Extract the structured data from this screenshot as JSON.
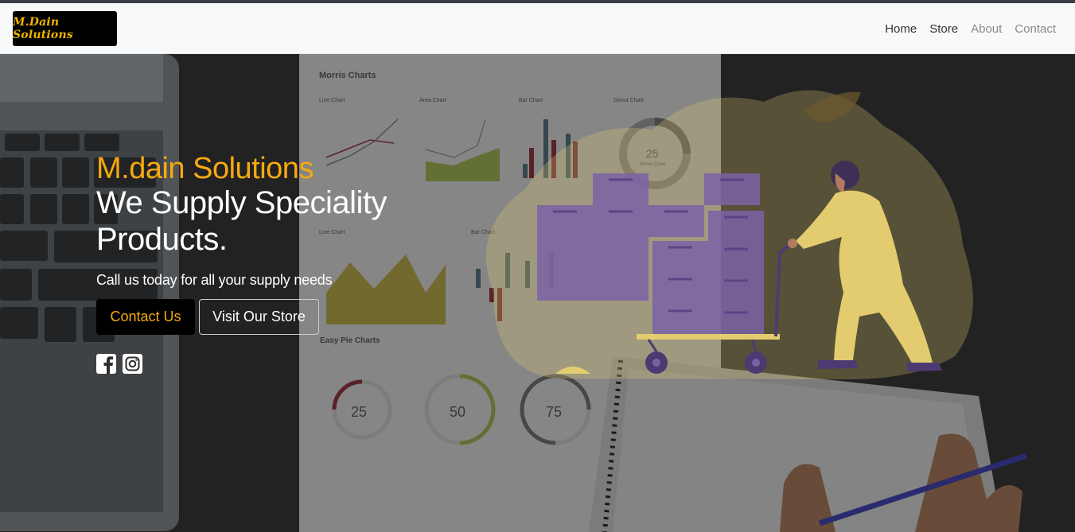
{
  "nav": {
    "brand": "M.Dain Solutions",
    "links": [
      {
        "label": "Home",
        "active": true
      },
      {
        "label": "Store",
        "active": true
      },
      {
        "label": "About",
        "active": false
      },
      {
        "label": "Contact",
        "active": false
      }
    ]
  },
  "hero": {
    "brand": "M.dain Solutions",
    "title_line1": "We Supply Speciality",
    "title_line2": "Products.",
    "subtitle": "Call us today for all your supply needs",
    "contact_button": "Contact Us",
    "store_button": "Visit Our Store"
  },
  "background": {
    "panel_title": "Morris Charts",
    "chart_labels": [
      "Line Chart",
      "Area Chart",
      "Bar Chart",
      "Donut Chart",
      "Line Chart",
      "Bar Chart",
      "Easy Pie Charts"
    ],
    "donut_value": "25",
    "donut_label": "Donut Chart",
    "pie_values": [
      "25",
      "50",
      "75"
    ]
  },
  "colors": {
    "accent": "#f7a90f",
    "figure": "#e2cc6f",
    "boxes": "#7a61a6"
  },
  "icons": [
    "facebook-icon",
    "instagram-icon"
  ]
}
